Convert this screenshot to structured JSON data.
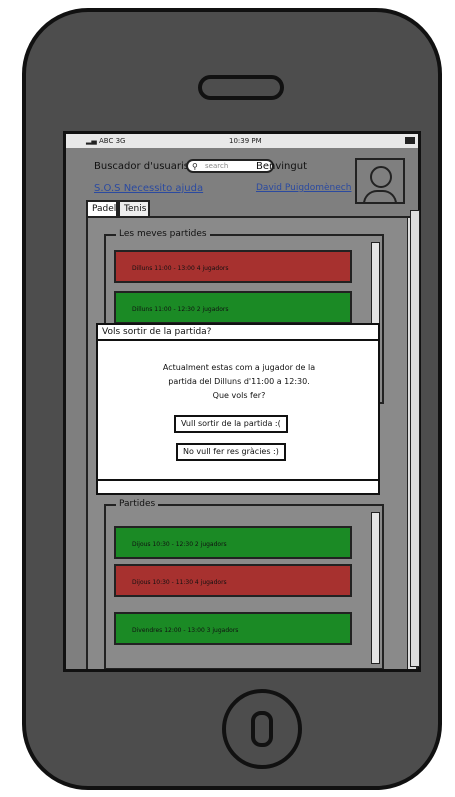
{
  "statusbar": {
    "carrier": "ABC 3G",
    "time": "10:39 PM"
  },
  "header": {
    "search_label": "Buscador d'usuaris",
    "search_placeholder": "search",
    "welcome": "Benvingut",
    "sos_link": "S.O.S Necessito ajuda",
    "user_name": "David Puigdomènech"
  },
  "tabs": [
    {
      "label": "Padel",
      "active": true
    },
    {
      "label": "Tenis",
      "active": false
    }
  ],
  "my_matches": {
    "title": "Les meves partides",
    "items": [
      {
        "text": "Dilluns 11:00 - 13:00 4 jugadors",
        "color": "#a7312f"
      },
      {
        "text": "Dilluns 11:00 - 12:30 2 jugadors",
        "color": "#1b8a25"
      }
    ]
  },
  "matches": {
    "title": "Partides",
    "items": [
      {
        "text": "Dijous 10:30 - 12:30 2 jugadors",
        "color": "#1b8a25"
      },
      {
        "text": "Dijous 10:30 - 11:30 4 jugadors",
        "color": "#a7312f"
      },
      {
        "text": "Divendres 12:00 - 13:00 3 jugadors",
        "color": "#1b8a25"
      }
    ]
  },
  "modal": {
    "title": "Vols sortir de la partida?",
    "message_line1": "Actualment estas com a jugador de la",
    "message_line2": "partida del Dilluns d'11:00 a 12:30.",
    "message_line3": "Que vols fer?",
    "confirm_label": "Vull sortir de la partida :(",
    "cancel_label": "No vull fer res gràcies :)"
  }
}
